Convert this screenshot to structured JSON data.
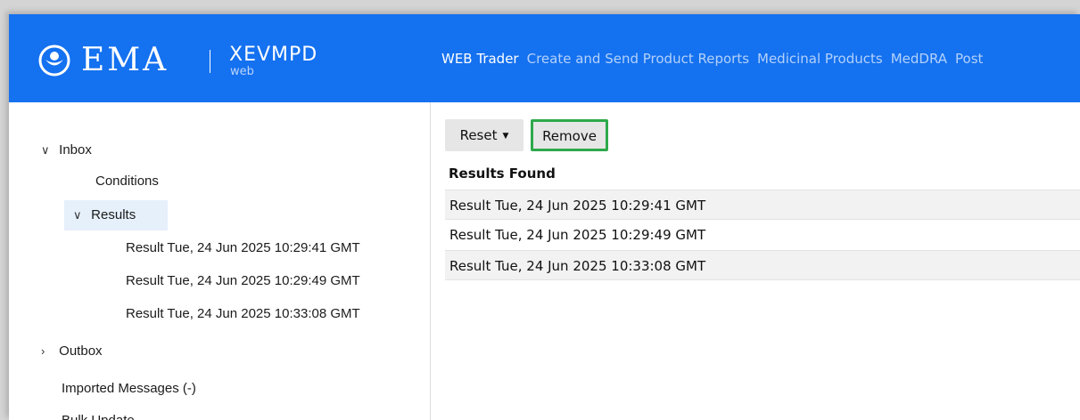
{
  "header": {
    "brand": "EMA",
    "app_name": "XEVMPD",
    "app_sub": "web",
    "nav": [
      {
        "label": "WEB Trader",
        "active": true
      },
      {
        "label": "Create and Send Product Reports",
        "active": false
      },
      {
        "label": "Medicinal Products",
        "active": false
      },
      {
        "label": "MedDRA",
        "active": false
      },
      {
        "label": "Post",
        "active": false
      }
    ]
  },
  "sidebar": {
    "inbox": "Inbox",
    "conditions": "Conditions",
    "results": "Results",
    "result_items": [
      "Result Tue, 24 Jun 2025 10:29:41 GMT",
      "Result Tue, 24 Jun 2025 10:29:49 GMT",
      "Result Tue, 24 Jun 2025 10:33:08 GMT"
    ],
    "outbox": "Outbox",
    "imported": "Imported Messages (-)",
    "bulk": "Bulk Update"
  },
  "main": {
    "reset_label": "Reset",
    "remove_label": "Remove",
    "results_title": "Results Found",
    "rows": [
      "Result Tue, 24 Jun 2025 10:29:41 GMT",
      "Result Tue, 24 Jun 2025 10:29:49 GMT",
      "Result Tue, 24 Jun 2025 10:33:08 GMT"
    ]
  },
  "colors": {
    "header_bg": "#1471f0",
    "highlight_border": "#2ea94b",
    "selected_node_bg": "#e6f0fb"
  },
  "icons": [
    "ema-logo-icon",
    "chevron-down-icon",
    "chevron-right-icon",
    "caret-down-icon"
  ]
}
